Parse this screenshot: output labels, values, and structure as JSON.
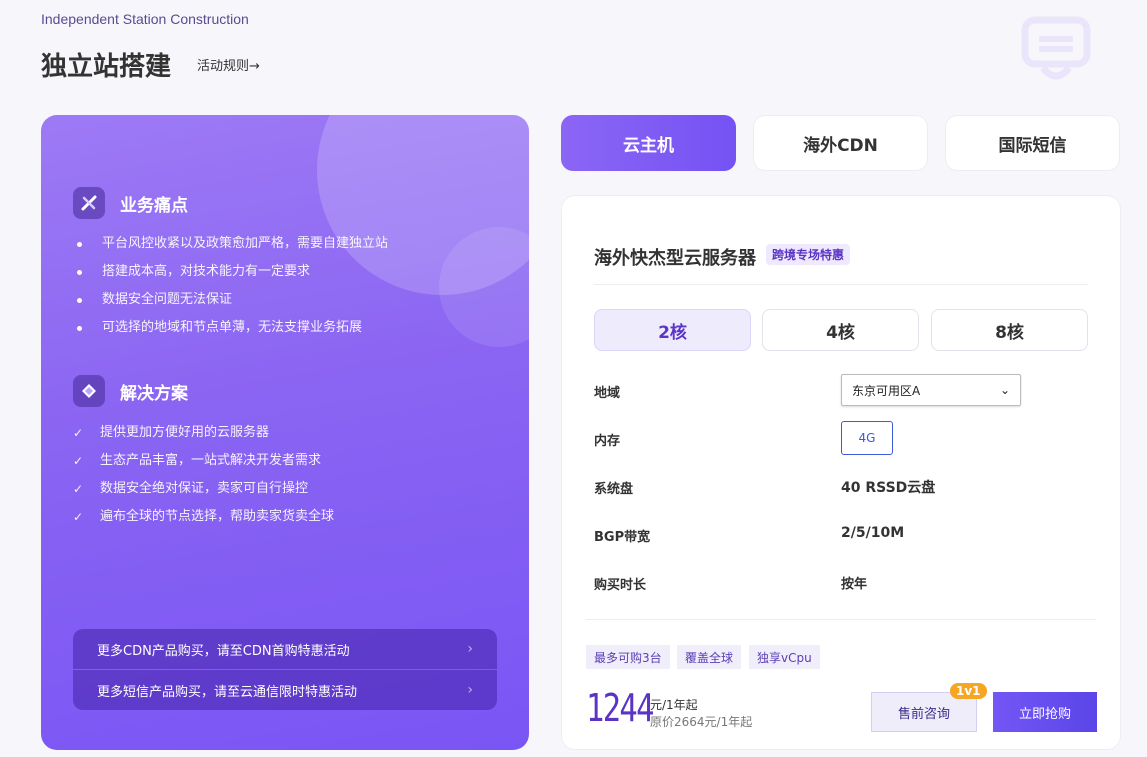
{
  "header": {
    "subtitle_en": "Independent Station Construction",
    "title": "独立站搭建",
    "rules_link": "活动规则→"
  },
  "left_panel": {
    "pain_points": {
      "title": "业务痛点",
      "items": [
        "平台风控收紧以及政策愈加严格，需要自建独立站",
        "搭建成本高，对技术能力有一定要求",
        "数据安全问题无法保证",
        "可选择的地域和节点单薄，无法支撑业务拓展"
      ]
    },
    "solutions": {
      "title": "解决方案",
      "items": [
        "提供更加方便好用的云服务器",
        "生态产品丰富，一站式解决开发者需求",
        "数据安全绝对保证，卖家可自行操控",
        "遍布全球的节点选择，帮助卖家货卖全球"
      ]
    },
    "promos": [
      "更多CDN产品购买，请至CDN首购特惠活动",
      "更多短信产品购买，请至云通信限时特惠活动"
    ]
  },
  "tabs": [
    "云主机",
    "海外CDN",
    "国际短信"
  ],
  "product": {
    "title": "海外快杰型云服务器",
    "badge": "跨境专场特惠",
    "cores": [
      "2核",
      "4核",
      "8核"
    ],
    "specs": {
      "region_label": "地域",
      "region_value": "东京可用区A",
      "memory_label": "内存",
      "memory_value": "4G",
      "disk_label": "系统盘",
      "disk_value": "40 RSSD云盘",
      "bandwidth_label": "BGP带宽",
      "bandwidth_value": "2/5/10M",
      "duration_label": "购买时长",
      "duration_value": "按年"
    },
    "tags": [
      "最多可购3台",
      "覆盖全球",
      "独享vCpu"
    ],
    "price": "1244",
    "price_unit": "元/1年起",
    "price_original": "原价2664元/1年起",
    "consult_button": "售前咨询",
    "consult_badge": "1v1",
    "buy_button": "立即抢购"
  },
  "colors": {
    "accent": "#7a55f5",
    "price": "#5a34c4",
    "badge": "#f5a623"
  }
}
